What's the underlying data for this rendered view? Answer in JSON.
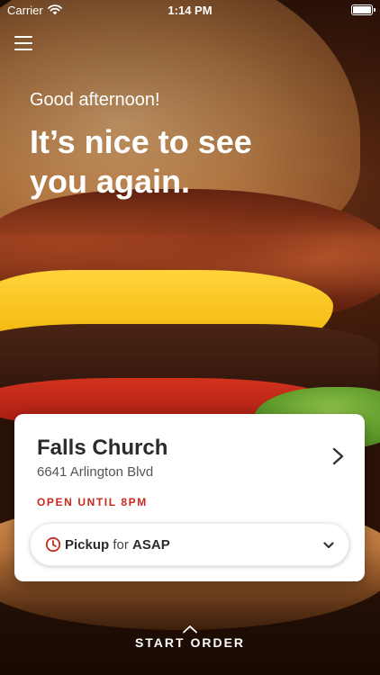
{
  "status_bar": {
    "carrier": "Carrier",
    "time": "1:14 PM"
  },
  "greeting": {
    "salutation": "Good afternoon!",
    "headline": "It’s nice to see you again."
  },
  "store": {
    "name": "Falls Church",
    "address": "6641 Arlington Blvd",
    "hours": "OPEN UNTIL 8PM"
  },
  "order_mode": {
    "mode": "Pickup",
    "connector": "for",
    "time": "ASAP"
  },
  "cta": {
    "start_order": "START ORDER"
  },
  "colors": {
    "accent_red": "#c8291c",
    "card_background": "#ffffff",
    "text_dark": "#2b2b2b"
  },
  "icons": [
    "menu-icon",
    "wifi-icon",
    "battery-icon",
    "chevron-right-icon",
    "clock-icon",
    "chevron-down-icon",
    "chevron-up-icon"
  ]
}
